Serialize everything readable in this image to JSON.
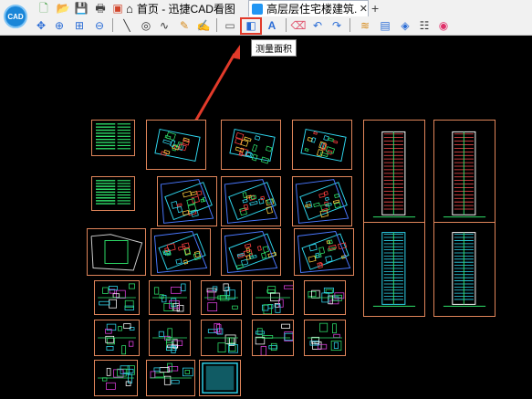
{
  "app": {
    "logo_text": "CAD"
  },
  "tabs": {
    "home": {
      "label": "首页 - 迅捷CAD看图",
      "icon": "home-icon"
    },
    "document": {
      "label": "高层层住宅楼建筑...",
      "close": "✕",
      "icon": "drawing-icon"
    },
    "add": {
      "label": "+"
    }
  },
  "tooltip": {
    "text": "测量面积"
  },
  "toolbar": {
    "row1": [
      "new-file-icon",
      "open-file-icon",
      "save-icon",
      "print-icon",
      "image-convert-icon"
    ],
    "row2": [
      "pan-icon",
      "zoom-window-icon",
      "zoom-extents-icon",
      "zoom-previous-icon",
      "line-icon",
      "circle-icon",
      "curve-icon",
      "pencil-icon",
      "text-edit-icon",
      "measure-length-icon",
      "measure-area-icon",
      "text-annotation-icon",
      "eraser-icon",
      "undo-icon",
      "redo-icon",
      "layers-icon",
      "layout-icon",
      "3d-view-icon",
      "properties-icon",
      "color-wheel-icon"
    ]
  },
  "colors": {
    "accent": "#e23a2a",
    "sheet_border": "#e0855a",
    "cad_green": "#2ee06a",
    "cad_cyan": "#2fd8f0",
    "cad_blue": "#4a78ff",
    "cad_magenta": "#e040e0"
  }
}
